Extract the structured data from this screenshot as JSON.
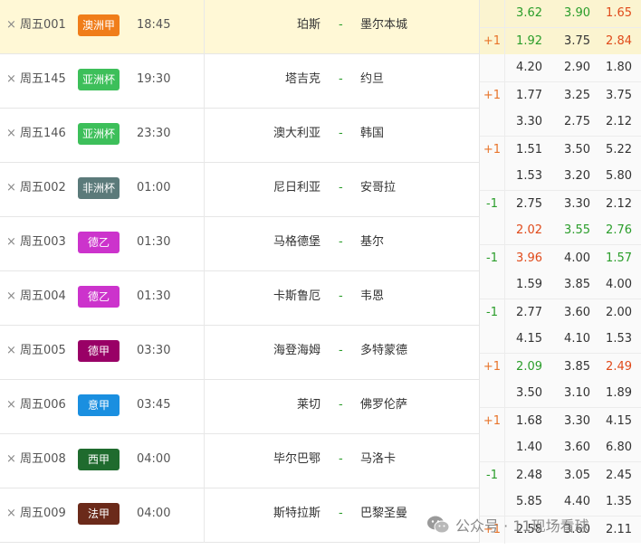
{
  "colors": {
    "highlight_row": "#fff8d6",
    "positive_handicap": "#e8742a",
    "negative_handicap": "#2a9d2a",
    "odds_up": "#e04a1a",
    "odds_down": "#2a9d2a",
    "vs_dash": "#2a9d2a"
  },
  "icons": {
    "close": "×",
    "watermark": "wechat-icon"
  },
  "matches": [
    {
      "code": "周五001",
      "league": "澳洲甲",
      "league_color": "#f07d1a",
      "time": "18:45",
      "home": "珀斯",
      "vs": "-",
      "away": "墨尔本城",
      "highlight": true,
      "line1": {
        "hc": "",
        "o1": "3.62",
        "o2": "3.90",
        "o3": "1.65",
        "c1": "green",
        "c2": "green",
        "c3": "red"
      },
      "line2": {
        "hc": "+1",
        "hc_color": "orange",
        "o1": "1.92",
        "o2": "3.75",
        "o3": "2.84",
        "c1": "green",
        "c2": "",
        "c3": "red"
      }
    },
    {
      "code": "周五145",
      "league": "亚洲杯",
      "league_color": "#3dbf5a",
      "time": "19:30",
      "home": "塔吉克",
      "vs": "-",
      "away": "约旦",
      "highlight": false,
      "line1": {
        "hc": "",
        "o1": "4.20",
        "o2": "2.90",
        "o3": "1.80",
        "c1": "",
        "c2": "",
        "c3": ""
      },
      "line2": {
        "hc": "+1",
        "hc_color": "orange",
        "o1": "1.77",
        "o2": "3.25",
        "o3": "3.75",
        "c1": "",
        "c2": "",
        "c3": ""
      }
    },
    {
      "code": "周五146",
      "league": "亚洲杯",
      "league_color": "#3dbf5a",
      "time": "23:30",
      "home": "澳大利亚",
      "vs": "-",
      "away": "韩国",
      "highlight": false,
      "line1": {
        "hc": "",
        "o1": "3.30",
        "o2": "2.75",
        "o3": "2.12",
        "c1": "",
        "c2": "",
        "c3": ""
      },
      "line2": {
        "hc": "+1",
        "hc_color": "orange",
        "o1": "1.51",
        "o2": "3.50",
        "o3": "5.22",
        "c1": "",
        "c2": "",
        "c3": ""
      }
    },
    {
      "code": "周五002",
      "league": "非洲杯",
      "league_color": "#5b7a7a",
      "time": "01:00",
      "home": "尼日利亚",
      "vs": "-",
      "away": "安哥拉",
      "highlight": false,
      "line1": {
        "hc": "",
        "o1": "1.53",
        "o2": "3.20",
        "o3": "5.80",
        "c1": "",
        "c2": "",
        "c3": ""
      },
      "line2": {
        "hc": "-1",
        "hc_color": "green",
        "o1": "2.75",
        "o2": "3.30",
        "o3": "2.12",
        "c1": "",
        "c2": "",
        "c3": ""
      }
    },
    {
      "code": "周五003",
      "league": "德乙",
      "league_color": "#cc33cc",
      "time": "01:30",
      "home": "马格德堡",
      "vs": "-",
      "away": "基尔",
      "highlight": false,
      "line1": {
        "hc": "",
        "o1": "2.02",
        "o2": "3.55",
        "o3": "2.76",
        "c1": "red",
        "c2": "green",
        "c3": "green"
      },
      "line2": {
        "hc": "-1",
        "hc_color": "green",
        "o1": "3.96",
        "o2": "4.00",
        "o3": "1.57",
        "c1": "red",
        "c2": "",
        "c3": "green"
      }
    },
    {
      "code": "周五004",
      "league": "德乙",
      "league_color": "#cc33cc",
      "time": "01:30",
      "home": "卡斯鲁厄",
      "vs": "-",
      "away": "韦恩",
      "highlight": false,
      "line1": {
        "hc": "",
        "o1": "1.59",
        "o2": "3.85",
        "o3": "4.00",
        "c1": "",
        "c2": "",
        "c3": ""
      },
      "line2": {
        "hc": "-1",
        "hc_color": "green",
        "o1": "2.77",
        "o2": "3.60",
        "o3": "2.00",
        "c1": "",
        "c2": "",
        "c3": ""
      }
    },
    {
      "code": "周五005",
      "league": "德甲",
      "league_color": "#990066",
      "time": "03:30",
      "home": "海登海姆",
      "vs": "-",
      "away": "多特蒙德",
      "highlight": false,
      "line1": {
        "hc": "",
        "o1": "4.15",
        "o2": "4.10",
        "o3": "1.53",
        "c1": "",
        "c2": "",
        "c3": ""
      },
      "line2": {
        "hc": "+1",
        "hc_color": "orange",
        "o1": "2.09",
        "o2": "3.85",
        "o3": "2.49",
        "c1": "green",
        "c2": "",
        "c3": "red"
      }
    },
    {
      "code": "周五006",
      "league": "意甲",
      "league_color": "#1a8fe0",
      "time": "03:45",
      "home": "莱切",
      "vs": "-",
      "away": "佛罗伦萨",
      "highlight": false,
      "line1": {
        "hc": "",
        "o1": "3.50",
        "o2": "3.10",
        "o3": "1.89",
        "c1": "",
        "c2": "",
        "c3": ""
      },
      "line2": {
        "hc": "+1",
        "hc_color": "orange",
        "o1": "1.68",
        "o2": "3.30",
        "o3": "4.15",
        "c1": "",
        "c2": "",
        "c3": ""
      }
    },
    {
      "code": "周五008",
      "league": "西甲",
      "league_color": "#1f6b2e",
      "time": "04:00",
      "home": "毕尔巴鄂",
      "vs": "-",
      "away": "马洛卡",
      "highlight": false,
      "line1": {
        "hc": "",
        "o1": "1.40",
        "o2": "3.60",
        "o3": "6.80",
        "c1": "",
        "c2": "",
        "c3": ""
      },
      "line2": {
        "hc": "-1",
        "hc_color": "green",
        "o1": "2.48",
        "o2": "3.05",
        "o3": "2.45",
        "c1": "",
        "c2": "",
        "c3": ""
      }
    },
    {
      "code": "周五009",
      "league": "法甲",
      "league_color": "#6b2a1a",
      "time": "04:00",
      "home": "斯特拉斯",
      "vs": "-",
      "away": "巴黎圣曼",
      "highlight": false,
      "line1": {
        "hc": "",
        "o1": "5.85",
        "o2": "4.40",
        "o3": "1.35",
        "c1": "",
        "c2": "",
        "c3": ""
      },
      "line2": {
        "hc": "+1",
        "hc_color": "orange",
        "o1": "2.58",
        "o2": "3.60",
        "o3": "2.11",
        "c1": "",
        "c2": "",
        "c3": ""
      }
    }
  ],
  "watermark": {
    "text": "公众号 · 11现场看球"
  }
}
